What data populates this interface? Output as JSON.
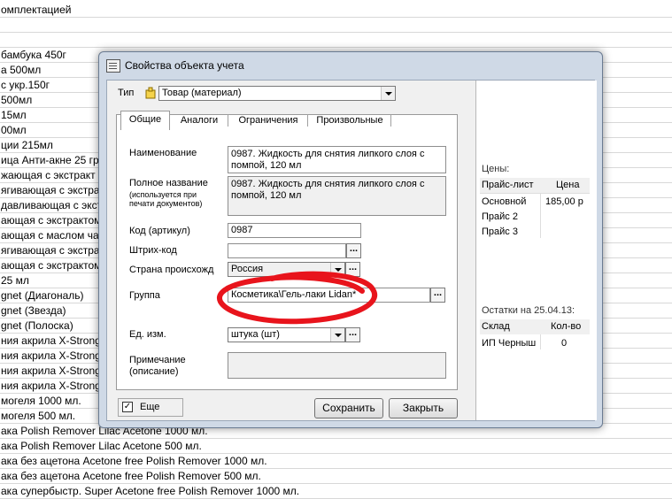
{
  "background_list": {
    "rows": [
      "омплектацией",
      "",
      "",
      "бамбука 450г",
      "а 500мл",
      "с укр.150г",
      "500мл",
      "15мл",
      "00мл",
      "ции 215мл",
      "ица Анти-акне 25 гр.",
      "жающая с экстракт",
      "ягивающая с экстракт",
      "давливающая с экстракт",
      "ающая с экстрактом Ш",
      "ающая с маслом чайно",
      "ягивающая с экстракт",
      "ающая с экстрактом К",
      "25 мл",
      "gnet (Диагональ)",
      "gnet (Звезда)",
      "gnet (Полоска)",
      "ния акрила  X-Stronge",
      "ния акрила  X-Stronge",
      "ния акрила  X-Stronge",
      "ния акрила  X-Stronge",
      "могеля 1000 мл.",
      "могеля 500 мл.",
      "ака Polish Remover Lilac Acetone 1000 мл.",
      "ака Polish Remover Lilac Acetone 500 мл.",
      "ака без ацетона Acetone free Polish Remover 1000 мл.",
      "ака без ацетона Acetone free Polish Remover 500 мл.",
      "ака супербыстр. Super Acetone free Polish Remover 1000 мл."
    ]
  },
  "dialog": {
    "title": "Свойства объекта учета",
    "type_label": "Тип",
    "type_value": "Товар (материал)",
    "tabs": [
      "Общие",
      "Аналоги",
      "Ограничения",
      "Произвольные"
    ],
    "fields": {
      "name_label": "Наименование",
      "name_value": "0987. Жидкость для снятия липкого слоя с помпой, 120 мл",
      "fullname_label": "Полное название",
      "fullname_hint": "(используется при печати документов)",
      "fullname_value": "0987. Жидкость для снятия липкого слоя с помпой, 120 мл",
      "code_label": "Код (артикул)",
      "code_value": "0987",
      "barcode_label": "Штрих-код",
      "barcode_value": "",
      "country_label": "Страна происхожд",
      "country_value": "Россия",
      "group_label": "Группа",
      "group_value": "Косметика\\Гель-лаки Lidan*",
      "unit_label": "Ед. изм.",
      "unit_value": "штука (шт)",
      "note_label": "Примечание (описание)",
      "note_value": ""
    },
    "more_checkbox_label": "Еще",
    "more_checked": true,
    "save_button": "Сохранить",
    "close_button": "Закрыть",
    "prices": {
      "title": "Цены:",
      "headers": [
        "Прайс-лист",
        "Цена"
      ],
      "rows": [
        {
          "name": "Основной",
          "price": "185,00 р"
        },
        {
          "name": "Прайс 2",
          "price": ""
        },
        {
          "name": "Прайс 3",
          "price": ""
        }
      ]
    },
    "stock": {
      "title": "Остатки на 25.04.13:",
      "headers": [
        "Склад",
        "Кол-во"
      ],
      "rows": [
        {
          "name": "ИП Черныш",
          "qty": "0"
        }
      ]
    }
  },
  "colors": {
    "dialog_frame": "#cfd9e6",
    "annotation_red": "#e8141c"
  }
}
